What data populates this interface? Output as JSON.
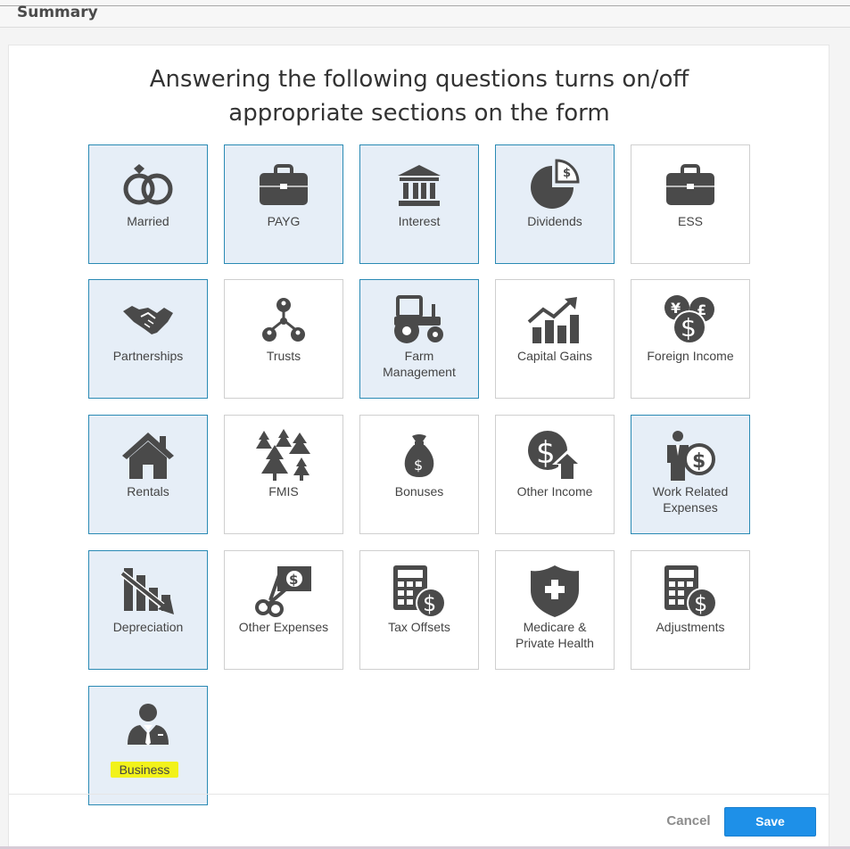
{
  "header": {
    "title": "Summary"
  },
  "heading": {
    "line1": "Answering the following questions turns on/off",
    "line2": "appropriate sections on the form"
  },
  "colors": {
    "selected_bg": "#e6eef7",
    "selected_border": "#2a8ab4",
    "icon": "#4a4a4a",
    "save": "#1e90e8",
    "highlight": "#f2f21a"
  },
  "tiles": [
    {
      "label": "Married",
      "selected": true,
      "icon": "rings-icon"
    },
    {
      "label": "PAYG",
      "selected": true,
      "icon": "briefcase-icon"
    },
    {
      "label": "Interest",
      "selected": true,
      "icon": "bank-icon"
    },
    {
      "label": "Dividends",
      "selected": true,
      "icon": "pie-chart-dollar-icon"
    },
    {
      "label": "ESS",
      "selected": false,
      "icon": "briefcase-icon"
    },
    {
      "label": "Partnerships",
      "selected": true,
      "icon": "handshake-icon"
    },
    {
      "label": "Trusts",
      "selected": false,
      "icon": "people-network-icon"
    },
    {
      "label": "Farm\nManagement",
      "selected": true,
      "icon": "tractor-icon"
    },
    {
      "label": "Capital Gains",
      "selected": false,
      "icon": "bar-chart-up-icon"
    },
    {
      "label": "Foreign Income",
      "selected": false,
      "icon": "currency-coins-icon"
    },
    {
      "label": "Rentals",
      "selected": true,
      "icon": "house-icon"
    },
    {
      "label": "FMIS",
      "selected": false,
      "icon": "trees-icon"
    },
    {
      "label": "Bonuses",
      "selected": false,
      "icon": "money-bag-icon"
    },
    {
      "label": "Other Income",
      "selected": false,
      "icon": "dollar-up-icon"
    },
    {
      "label": "Work Related\nExpenses",
      "selected": true,
      "icon": "person-dollar-icon"
    },
    {
      "label": "Depreciation",
      "selected": true,
      "icon": "bar-chart-down-icon"
    },
    {
      "label": "Other Expenses",
      "selected": false,
      "icon": "scissors-dollar-icon"
    },
    {
      "label": "Tax Offsets",
      "selected": false,
      "icon": "calculator-dollar-icon"
    },
    {
      "label": "Medicare &\nPrivate Health",
      "selected": false,
      "icon": "shield-plus-icon"
    },
    {
      "label": "Adjustments",
      "selected": false,
      "icon": "calculator-dollar-icon"
    },
    {
      "label": "Business",
      "selected": true,
      "icon": "businessman-icon",
      "highlighted": true
    }
  ],
  "footer": {
    "cancel_label": "Cancel",
    "save_label": "Save"
  }
}
